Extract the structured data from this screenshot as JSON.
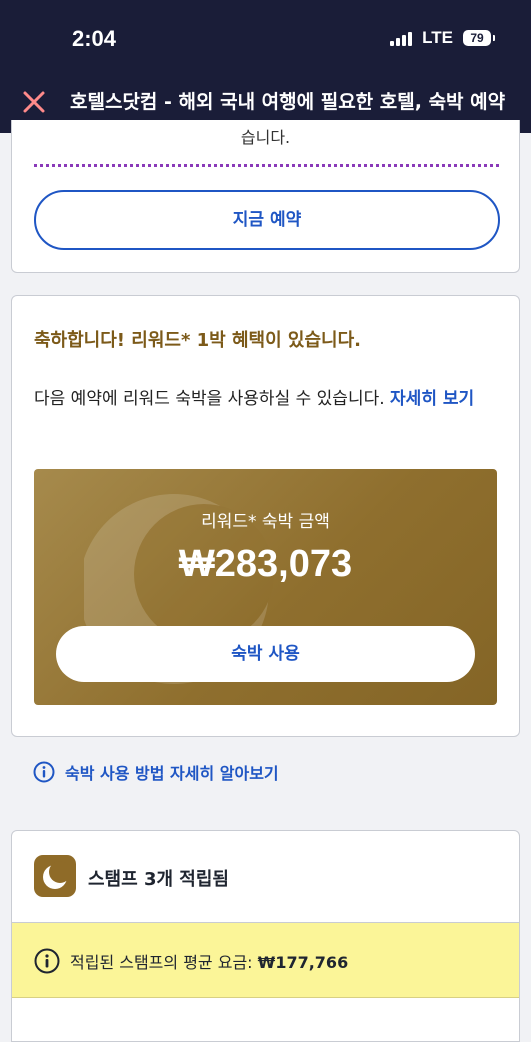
{
  "status_bar": {
    "time": "2:04",
    "network": "LTE",
    "battery": "79"
  },
  "browser": {
    "title": "호텔스닷컴 - 해외 국내 여행에 필요한 호텔, 숙박 예약"
  },
  "booking_card": {
    "partial_text": "습니다.",
    "book_now_label": "지금 예약"
  },
  "reward_card": {
    "heading": "축하합니다! 리워드* 1박 혜택이 있습니다.",
    "description": "다음 예약에 리워드 숙박을 사용하실 수 있습니다.",
    "details_link": "자세히 보기",
    "panel_label": "리워드* 숙박 금액",
    "panel_amount": "₩283,073",
    "use_button_label": "숙박 사용"
  },
  "help_link": {
    "label": "숙박 사용 방법 자세히 알아보기"
  },
  "stamps_card": {
    "title": "스탬프 3개 적립됨",
    "avg_label": "적립된 스탬프의 평균 요금:",
    "avg_value": "₩177,766"
  },
  "colors": {
    "header_bg": "#1a1d38",
    "link_blue": "#1f56c4",
    "reward_gold": "#8f6f2e",
    "heading_gold": "#7c5a19",
    "highlight_yellow": "#fbf598"
  }
}
